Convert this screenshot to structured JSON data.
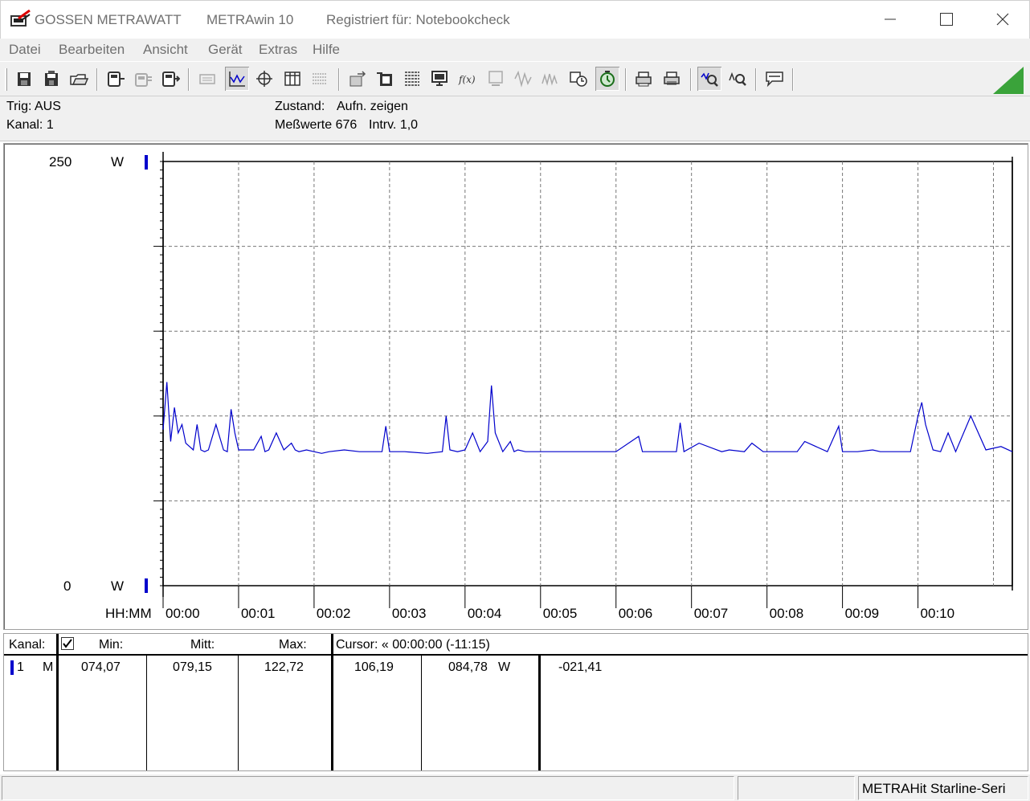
{
  "titlebar": {
    "brand": "GOSSEN METRAWATT",
    "app": "METRAwin 10",
    "registration": "Registriert für: Notebookcheck"
  },
  "menu": [
    "Datei",
    "Bearbeiten",
    "Ansicht",
    "Gerät",
    "Extras",
    "Hilfe"
  ],
  "info": {
    "trig": "Trig: AUS",
    "kanal": "Kanal: 1",
    "zustand_label": "Zustand:",
    "zustand_value": "Aufn. zeigen",
    "messwerte": "Meßwerte 676",
    "intrv": "Intrv. 1,0"
  },
  "chart_data": {
    "type": "line",
    "ylim": [
      0,
      250
    ],
    "y_top_label": "250",
    "y_bottom_label": "0",
    "y_unit": "W",
    "x_axis_label": "HH:MM",
    "x_tick_labels": [
      "00:00",
      "00:01",
      "00:02",
      "00:03",
      "00:04",
      "00:05",
      "00:06",
      "00:07",
      "00:08",
      "00:09",
      "00:10"
    ],
    "xlim_minutes": [
      0,
      11.25
    ],
    "grid": true,
    "line_color": "#0000cc",
    "series": [
      {
        "x": [
          0,
          0.05,
          0.1,
          0.15,
          0.2,
          0.25,
          0.3,
          0.35,
          0.4,
          0.45,
          0.5,
          0.55,
          0.6,
          0.7,
          0.8,
          0.85,
          0.9,
          0.95,
          1.0,
          1.2,
          1.3,
          1.35,
          1.4,
          1.5,
          1.6,
          1.7,
          1.75,
          1.8,
          1.9,
          2.0,
          2.1,
          2.2,
          2.4,
          2.6,
          2.9,
          2.95,
          3.0,
          3.2,
          3.5,
          3.7,
          3.75,
          3.8,
          3.9,
          4.0,
          4.1,
          4.2,
          4.3,
          4.35,
          4.4,
          4.5,
          4.6,
          4.65,
          4.7,
          4.8,
          5.0,
          5.2,
          5.4,
          5.6,
          6.0,
          6.3,
          6.35,
          6.4,
          6.5,
          6.8,
          6.85,
          6.9,
          7.1,
          7.4,
          7.5,
          7.7,
          7.8,
          7.95,
          8.0,
          8.1,
          8.4,
          8.5,
          8.8,
          8.95,
          9.0,
          9.05,
          9.1,
          9.2,
          9.4,
          9.5,
          9.6,
          9.75,
          9.9,
          10.0,
          10.05,
          10.1,
          10.2,
          10.3,
          10.4,
          10.5,
          10.7,
          10.9,
          11.1,
          11.25
        ],
        "values": [
          92,
          120,
          85,
          105,
          90,
          95,
          84,
          82,
          80,
          95,
          80,
          79,
          80,
          95,
          80,
          79,
          104,
          90,
          80,
          80,
          88,
          79,
          80,
          90,
          80,
          84,
          80,
          79,
          80,
          79,
          78,
          79,
          80,
          79,
          79,
          94,
          79,
          79,
          78,
          79,
          100,
          80,
          79,
          80,
          90,
          79,
          85,
          118,
          90,
          79,
          85,
          79,
          80,
          79,
          79,
          79,
          79,
          79,
          79,
          88,
          79,
          79,
          79,
          79,
          96,
          79,
          84,
          79,
          80,
          79,
          84,
          79,
          79,
          79,
          79,
          85,
          79,
          94,
          79,
          79,
          79,
          79,
          80,
          79,
          79,
          79,
          79,
          100,
          108,
          95,
          80,
          79,
          90,
          79,
          100,
          80,
          82,
          79
        ]
      }
    ]
  },
  "table": {
    "headers": {
      "kanal": "Kanal:",
      "min": "Min:",
      "mitt": "Mitt:",
      "max": "Max:",
      "cursor": "Cursor: « 00:00:00 (-11:15)"
    },
    "row": {
      "channel": "1",
      "mode": "M",
      "min": "074,07",
      "mitt": "079,15",
      "max": "122,72",
      "cursor1": "106,19",
      "cursor2": "084,78",
      "unit": "W",
      "diff": "-021,41"
    }
  },
  "status": {
    "device": "METRAHit Starline-Seri"
  }
}
